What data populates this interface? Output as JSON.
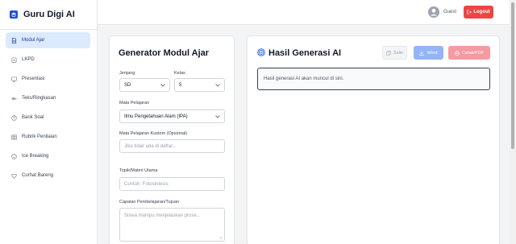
{
  "app": {
    "title": "Guru Digi AI"
  },
  "sidebar": {
    "items": [
      {
        "label": "Modul Ajar",
        "icon": "document-icon",
        "active": true
      },
      {
        "label": "LKPD",
        "icon": "clipboard-icon",
        "active": false
      },
      {
        "label": "Presentasi",
        "icon": "monitor-icon",
        "active": false
      },
      {
        "label": "Teks/Ringkasan",
        "icon": "text-icon",
        "active": false
      },
      {
        "label": "Bank Soal",
        "icon": "question-icon",
        "active": false
      },
      {
        "label": "Rubrik Penilaian",
        "icon": "table-icon",
        "active": false
      },
      {
        "label": "Ice Breaking",
        "icon": "smile-icon",
        "active": false
      },
      {
        "label": "Curhat Bareng",
        "icon": "heart-icon",
        "active": false
      }
    ]
  },
  "header": {
    "user_name": "Guest",
    "logout_label": "Logout"
  },
  "form": {
    "title": "Generator Modul Ajar",
    "jenjang": {
      "label": "Jenjang",
      "value": "SD"
    },
    "kelas": {
      "label": "Kelas",
      "value": "5"
    },
    "mapel": {
      "label": "Mata Pelajaran",
      "value": "Ilmu Pengetahuan Alam (IPA)"
    },
    "mapel_kustom": {
      "label": "Mata Pelajaran Kustom (Opsional)",
      "placeholder": "Jika tidak ada di daftar..."
    },
    "topik": {
      "label": "Topik/Materi Utama",
      "placeholder": "Contoh: Fotosintesis"
    },
    "capaian": {
      "label": "Capaian Pembelajaran/Tujuan",
      "placeholder": "Siswa mampu menjelaskan prose..."
    }
  },
  "result": {
    "title": "Hasil Generasi AI",
    "copy_label": "Salin",
    "word_label": "Word",
    "pdf_label": "Cetak/PDF",
    "placeholder_text": "Hasil generasi AI akan muncul di sini."
  },
  "colors": {
    "primary": "#2563eb",
    "active_bg": "#dbeafe",
    "danger": "#ef4444"
  }
}
